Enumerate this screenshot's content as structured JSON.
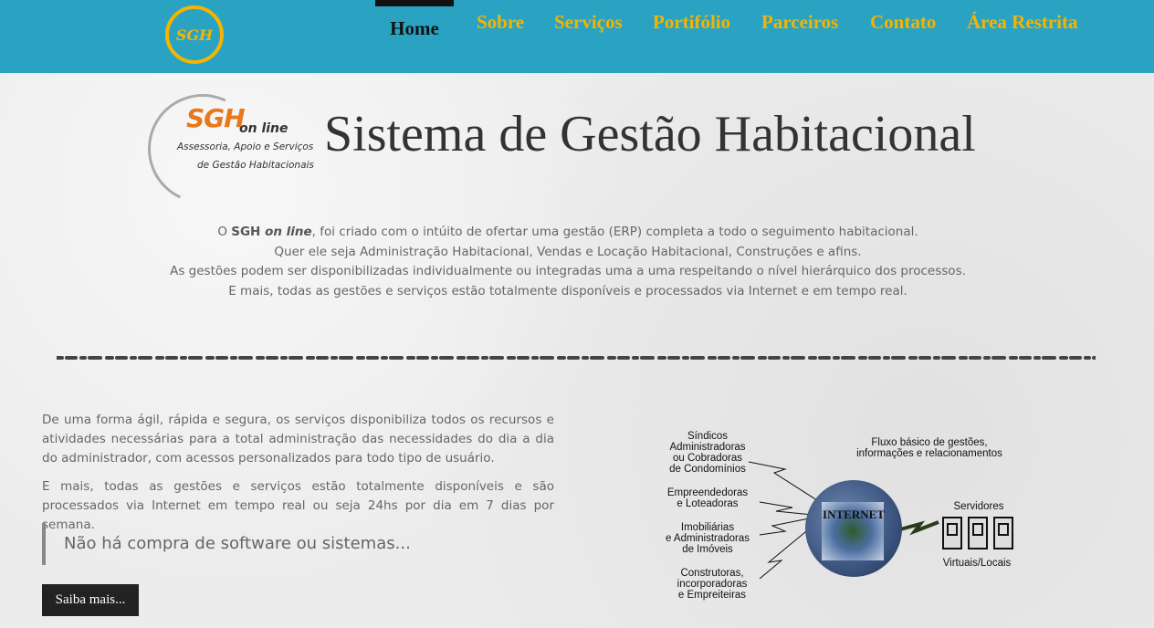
{
  "header": {
    "logo_text": "SGH",
    "nav": [
      {
        "label": "Home",
        "active": true
      },
      {
        "label": "Sobre"
      },
      {
        "label": "Serviços"
      },
      {
        "label": "Portifólio"
      },
      {
        "label": "Parceiros"
      },
      {
        "label": "Contato"
      },
      {
        "label": "Área Restrita"
      }
    ]
  },
  "hero": {
    "logo_mark": "SGH",
    "logo_online": "on line",
    "logo_sub1": "Assessoria, Apoio e Serviços",
    "logo_sub2": "de Gestão Habitacionais",
    "title": "Sistema de Gestão Habitacional"
  },
  "intro": {
    "line1_pre": "O ",
    "line1_bold": "SGH ",
    "line1_italic": "on line",
    "line1_post": ", foi criado com o intúito de ofertar uma gestão (ERP) completa a todo o seguimento habitacional.",
    "line2": "Quer ele seja Administração Habitacional, Vendas e Locação Habitacional, Construções e afins.",
    "line3": "As gestões podem ser disponibilizadas individualmente ou integradas uma a uma respeitando o nível hierárquico dos processos.",
    "line4": "E mais, todas as gestões e serviços estão totalmente disponíveis e processados via Internet e em tempo real."
  },
  "body": {
    "paragraph1": "De uma forma ágil, rápida e segura, os serviços disponibiliza todos os recursos e atividades necessárias para a total administração das necessidades do dia a dia do administrador, com acessos personalizados para todo tipo de usuário.",
    "paragraph2": "E mais, todas as gestões e serviços estão totalmente disponíveis e são processados via Internet em tempo real ou seja 24hs por dia em 7 dias por semana.",
    "quote": "Não há compra de software ou sistemas...",
    "button_label": "Saiba mais..."
  },
  "diagram": {
    "title_line1": "Fluxo básico de gestões,",
    "title_line2": "informações e relacionamentos",
    "group1": [
      "Síndicos",
      "Administradoras",
      "ou Cobradoras",
      "de Condomínios"
    ],
    "group2": [
      "Empreendedoras",
      "e Loteadoras"
    ],
    "group3": [
      "Imobiliárias",
      "e Administradoras",
      "de Imóveis"
    ],
    "group4": [
      "Construtoras,",
      "incorporadoras",
      "e Empreiteiras"
    ],
    "internet_label": "INTERNET",
    "servers_label": "Servidores",
    "servers_sub": "Virtuais/Locais"
  },
  "colors": {
    "header_bg": "#2aa3c2",
    "nav_text": "#f5b400",
    "accent_orange": "#e8781a"
  }
}
